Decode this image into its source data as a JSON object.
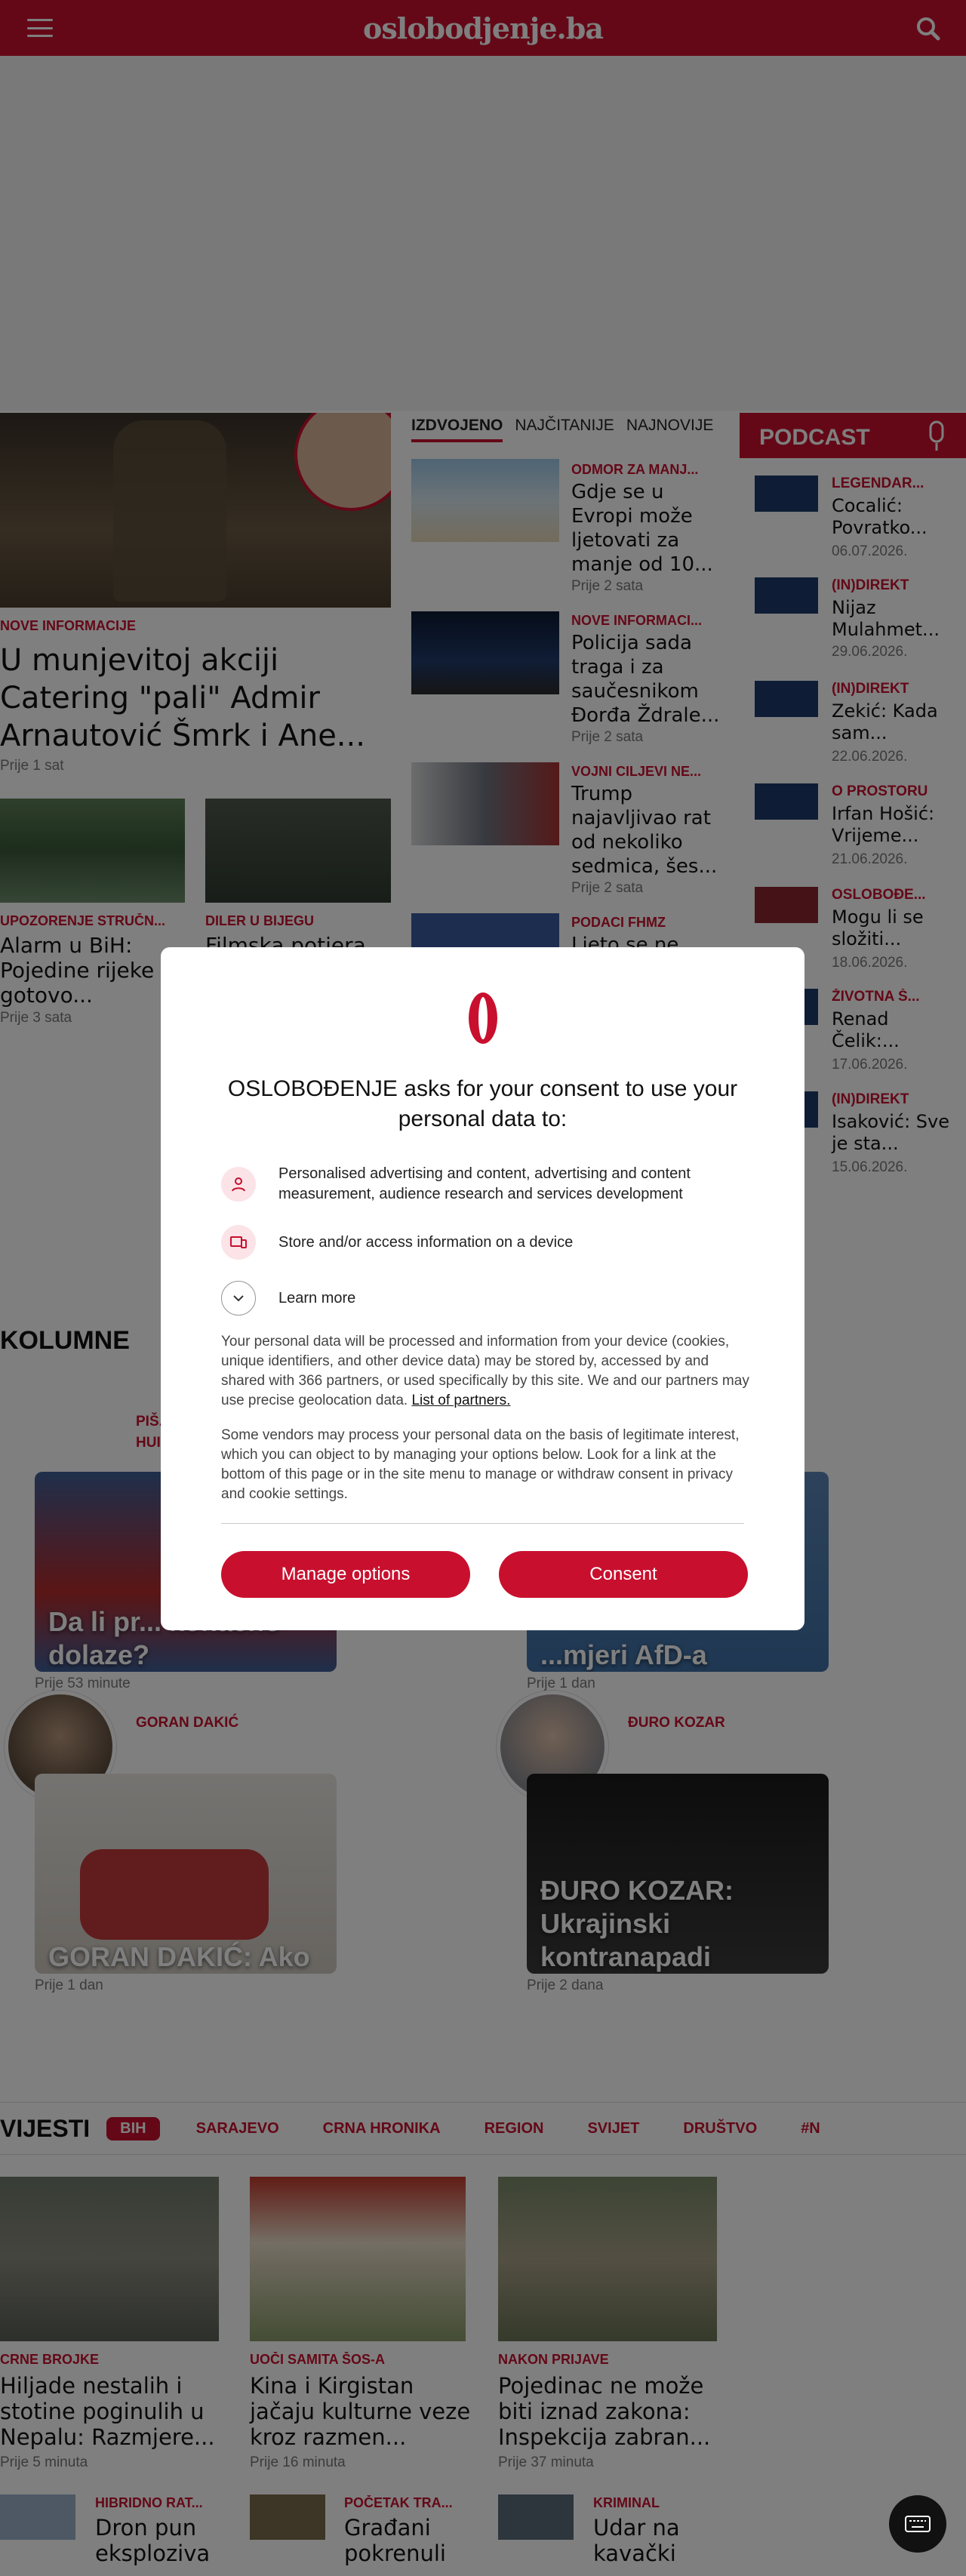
{
  "header": {
    "logo": "oslobodjenje.ba",
    "menu_icon": "hamburger-icon",
    "search_icon": "search-icon"
  },
  "lead": {
    "kicker": "NOVE INFORMACIJE",
    "title": "U munjevitoj akciji Catering \"pali\" Admir Arnautović Šmrk i Ane...",
    "time": "Prije 1 sat"
  },
  "small_left": [
    {
      "kicker": "UPOZORENJE STRUČN...",
      "title": "Alarm u BiH: Pojedine rijeke gotovo...",
      "time": "Prije 3 sata"
    },
    {
      "kicker": "DILER U BIJEGU",
      "title": "Filmska potjera..."
    }
  ],
  "tabs": [
    "IZDVOJENO",
    "NAJČITANIJE",
    "NAJNOVIJE"
  ],
  "featured": [
    {
      "kicker": "ODMOR ZA MANJ...",
      "title": "Gdje se u Evropi može ljetovati za manje od 10...",
      "time": "Prije 2 sata"
    },
    {
      "kicker": "NOVE INFORMACI...",
      "title": "Policija sada traga i za saučesnikom Đorđa Ždrale...",
      "time": "Prije 2 sata"
    },
    {
      "kicker": "VOJNI CILJEVI NE...",
      "title": "Trump najavljivao rat od nekoliko sedmica, šes...",
      "time": "Prije 2 sata"
    },
    {
      "kicker": "PODACI FHMZ",
      "title": "Ljeto se ne..."
    }
  ],
  "podcast": {
    "title": "PODCAST",
    "items": [
      {
        "kicker": "LEGENDAR...",
        "title": "Cocalić: Povratko...",
        "date": "06.07.2026."
      },
      {
        "kicker": "(IN)DIREKT",
        "title": "Nijaz Mulahmet...",
        "date": "29.06.2026."
      },
      {
        "kicker": "(IN)DIREKT",
        "title": "Zekić: Kada sam...",
        "date": "22.06.2026."
      },
      {
        "kicker": "O PROSTORU",
        "title": "Irfan Hošić: Vrijeme...",
        "date": "21.06.2026."
      },
      {
        "kicker": "OSLOBOĐE...",
        "title": "Mogu li se složiti...",
        "date": "18.06.2026."
      },
      {
        "kicker": "ŽIVOTNA Š...",
        "title": "Renad Čelik:...",
        "date": "17.06.2026."
      },
      {
        "kicker": "(IN)DIREKT",
        "title": "Isaković: Sve je sta...",
        "date": "15.06.2026."
      }
    ]
  },
  "columns": {
    "title": "KOLUMNE",
    "cards": [
      {
        "author": "PIŠ... HUI...",
        "title": "Da li pr... konačno dolaze?",
        "time": "Prije 53 minute"
      },
      {
        "author": "",
        "title": "...mjeri AfD-a",
        "time": "Prije 1 dan"
      },
      {
        "author": "GORAN DAKIĆ",
        "title": "GORAN DAKIĆ: Ako",
        "time": "Prije 1 dan"
      },
      {
        "author": "ĐURO KOZAR",
        "title": "ĐURO KOZAR: Ukrajinski kontranapadi",
        "time": "Prije 2 dana"
      }
    ]
  },
  "news": {
    "title": "VIJESTI",
    "nav": [
      "BIH",
      "SARAJEVO",
      "CRNA HRONIKA",
      "REGION",
      "SVIJET",
      "DRUŠTVO",
      "#N"
    ],
    "cards": [
      {
        "kicker": "CRNE BROJKE",
        "title": "Hiljade nestalih i stotine poginulih u Nepalu: Razmjere...",
        "time": "Prije 5 minuta"
      },
      {
        "kicker": "UOČI SAMITA ŠOS-A",
        "title": "Kina i Kirgistan jačaju kulturne veze kroz razmen...",
        "time": "Prije 16 minuta"
      },
      {
        "kicker": "NAKON PRIJAVE",
        "title": "Pojedinac ne može biti iznad zakona: Inspekcija zabran...",
        "time": "Prije 37 minuta"
      }
    ],
    "small": [
      {
        "kicker": "HIBRIDNO RAT...",
        "title": "Dron pun eksploziva"
      },
      {
        "kicker": "POČETAK TRA...",
        "title": "Građani pokrenuli"
      },
      {
        "kicker": "KRIMINAL",
        "title": "Udar na kavački"
      }
    ]
  },
  "consent": {
    "heading": "OSLOBOĐENJE asks for your consent to use your personal data to:",
    "purposes": [
      {
        "icon": "person-icon",
        "text": "Personalised advertising and content, advertising and content measurement, audience research and services development"
      },
      {
        "icon": "device-icon",
        "text": "Store and/or access information on a device"
      }
    ],
    "learn_more": "Learn more",
    "para1": "Your personal data will be processed and information from your device (cookies, unique identifiers, and other device data) may be stored by, accessed by and shared with 366 partners, or used specifically by this site. We and our partners may use precise geolocation data.",
    "partners_link": "List of partners.",
    "para2": "Some vendors may process your personal data on the basis of legitimate interest, which you can object to by managing your options below. Look for a link at the bottom of this page or in the site menu to manage or withdraw consent in privacy and cookie settings.",
    "manage_btn": "Manage options",
    "consent_btn": "Consent"
  },
  "colors": {
    "brand": "#c8102e",
    "overlay": "rgba(0,0,0,0.5)"
  }
}
